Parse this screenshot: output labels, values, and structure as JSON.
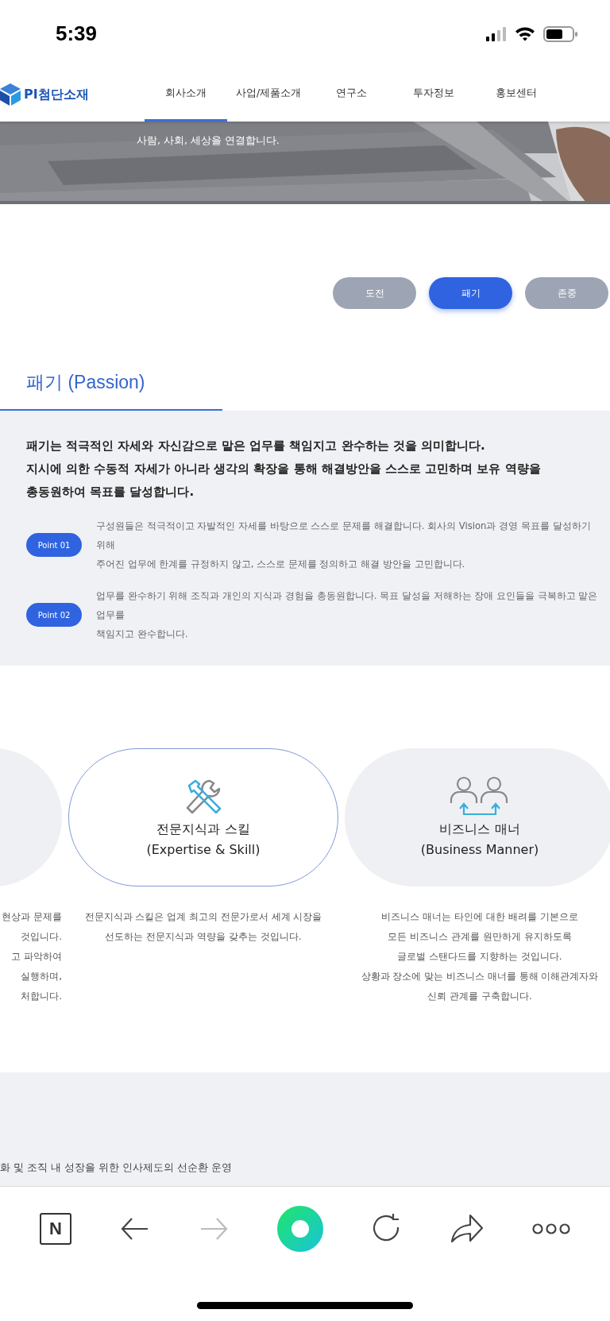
{
  "status_bar": {
    "time": "5:39"
  },
  "header": {
    "logo": "PI첨단소재",
    "nav": [
      {
        "label": "회사소개",
        "selected": true
      },
      {
        "label": "사업/제품소개",
        "selected": false
      },
      {
        "label": "연구소",
        "selected": false
      },
      {
        "label": "투자정보",
        "selected": false
      },
      {
        "label": "홍보센터",
        "selected": false
      }
    ]
  },
  "hero": {
    "kind": "picture",
    "caption": "사람, 사회, 세상을 연결합니다."
  },
  "value_tabs": [
    {
      "label": "도전",
      "selected": false
    },
    {
      "label": "패기",
      "selected": true
    },
    {
      "label": "존중",
      "selected": false
    }
  ],
  "section": {
    "title": "패기 (Passion)",
    "intro": [
      "패기는 적극적인 자세와 자신감으로 맡은 업무를 책임지고 완수하는 것을 의미합니다.",
      "지시에 의한 수동적 자세가 아니라 생각의 확장을 통해 해결방안을 스스로 고민하며 보유 역량을",
      "총동원하여 목표를 달성합니다."
    ],
    "points": [
      {
        "badge": "Point 01",
        "lines": [
          "구성원들은 적극적이고 자발적인 자세를 바탕으로 스스로 문제를 해결합니다. 회사의 Vision과 경영 목표를 달성하기",
          "위해",
          "주어진 업무에 한계를 규정하지 않고, 스스로 문제를 정의하고 해결 방안을 고민합니다."
        ]
      },
      {
        "badge": "Point 02",
        "lines": [
          "업무를 완수하기 위해 조직과 개인의 지식과 경험을 총동원합니다. 목표 달성을 저해하는 장애 요인들을 극복하고 맡은",
          "업무를",
          "책임지고 완수합니다."
        ]
      }
    ]
  },
  "cards": [
    {
      "kind": "cropped",
      "description": [
        "현상과 문제를",
        "것입니다.",
        "고 파악하여",
        "실행하며,",
        "처합니다."
      ]
    },
    {
      "kind": "outlined",
      "title": "전문지식과 스킬",
      "subtitle": "(Expertise & Skill)",
      "description": [
        "전문지식과 스킬은 업계 최고의 전문가로서 세계 시장을",
        "선도하는 전문지식과 역량을 갖추는 것입니다."
      ]
    },
    {
      "kind": "filled",
      "title": "비즈니스 매너",
      "subtitle": "(Business Manner)",
      "description": [
        "비즈니스 매너는 타인에 대한 배려를 기본으로",
        "모든 비즈니스 관계를 원만하게 유지하도록",
        "글로벌 스탠다드를 지향하는 것입니다.",
        "상황과 장소에 맞는 비즈니스 매너를 통해 이해관계자와",
        "신뢰 관계를 구축합니다."
      ]
    }
  ],
  "next_section": {
    "text": "화 및 조직 내 성장을 위한 인사제도의 선순환 운영"
  },
  "browser_toolbar": {
    "home_label": "N",
    "forward": {
      "disabled": true
    }
  }
}
